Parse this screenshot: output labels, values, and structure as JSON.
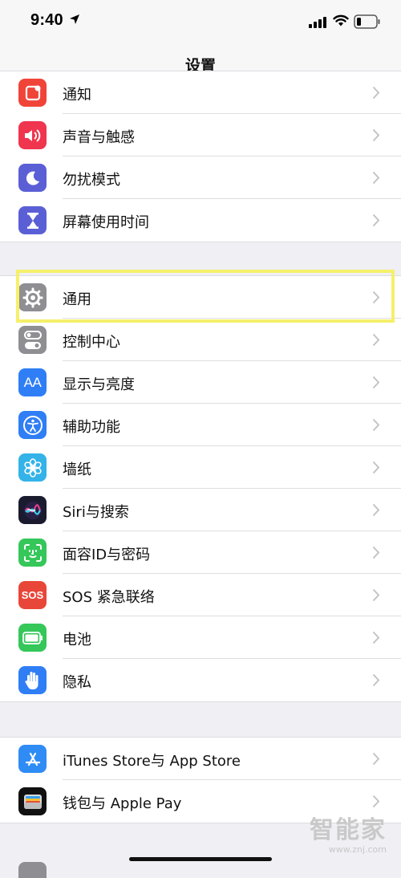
{
  "status_bar": {
    "time": "9:40"
  },
  "nav": {
    "title": "设置"
  },
  "groups": [
    {
      "items": [
        {
          "label": "通知",
          "icon": "notifications-icon",
          "color": "#f04438"
        },
        {
          "label": "声音与触感",
          "icon": "speaker-icon",
          "color": "#f0354f"
        },
        {
          "label": "勿扰模式",
          "icon": "moon-icon",
          "color": "#5b5fd6"
        },
        {
          "label": "屏幕使用时间",
          "icon": "hourglass-icon",
          "color": "#5b5fd6"
        }
      ]
    },
    {
      "items": [
        {
          "label": "通用",
          "icon": "gear-icon",
          "color": "#8e8e93"
        },
        {
          "label": "控制中心",
          "icon": "toggles-icon",
          "color": "#8e8e93"
        },
        {
          "label": "显示与亮度",
          "icon": "text-size-icon",
          "color": "#2f7ef5"
        },
        {
          "label": "辅助功能",
          "icon": "accessibility-icon",
          "color": "#2f7ef5"
        },
        {
          "label": "墙纸",
          "icon": "flower-icon",
          "color": "#33b3e8"
        },
        {
          "label": "Siri与搜索",
          "icon": "siri-icon",
          "color": "#1b1b2f"
        },
        {
          "label": "面容ID与密码",
          "icon": "face-id-icon",
          "color": "#35c759"
        },
        {
          "label": "SOS 紧急联络",
          "icon": "sos-icon",
          "color": "#e9463a"
        },
        {
          "label": "电池",
          "icon": "battery-icon",
          "color": "#35c759"
        },
        {
          "label": "隐私",
          "icon": "hand-icon",
          "color": "#2f7ef5"
        }
      ]
    },
    {
      "items": [
        {
          "label": "iTunes Store与 App Store",
          "icon": "app-store-icon",
          "color": "#2f8cf5"
        },
        {
          "label": "钱包与 Apple Pay",
          "icon": "wallet-icon",
          "color": "#111111"
        }
      ]
    }
  ],
  "sos_text": "SOS",
  "text_size_glyph": "AA",
  "watermark": {
    "logo": "智能家",
    "url": "www.znj.com"
  },
  "highlight_color": "#f5f06a"
}
